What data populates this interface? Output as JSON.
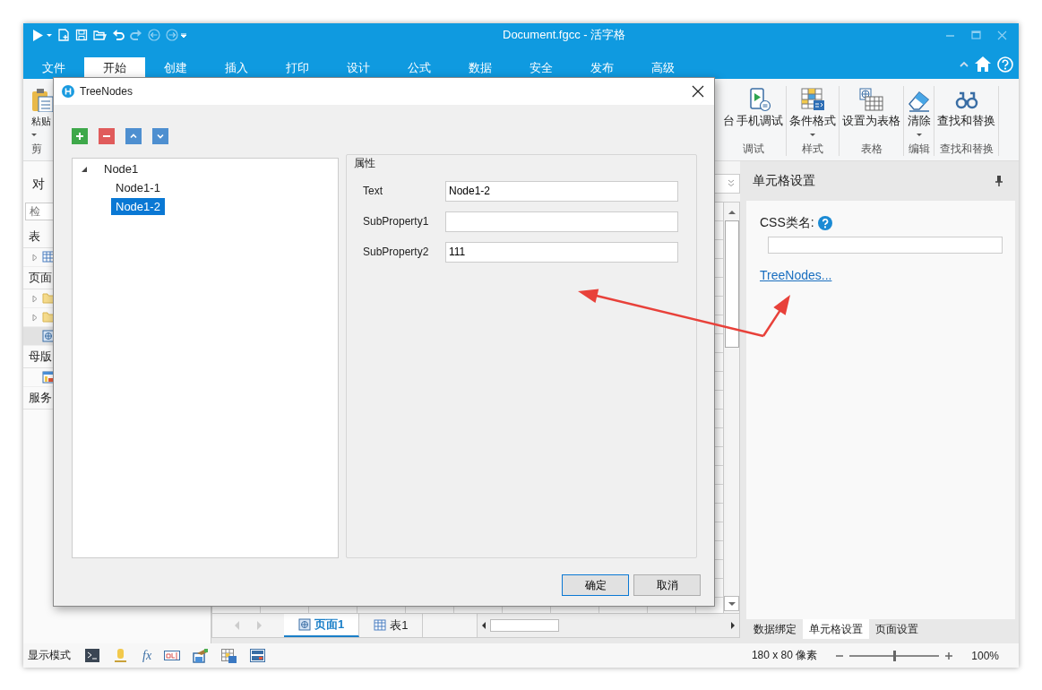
{
  "window": {
    "title": "Document.fgcc - 活字格"
  },
  "ribbon_tabs": [
    {
      "label": "文件",
      "selected": false
    },
    {
      "label": "开始",
      "selected": true
    },
    {
      "label": "创建",
      "selected": false
    },
    {
      "label": "插入",
      "selected": false
    },
    {
      "label": "打印",
      "selected": false
    },
    {
      "label": "设计",
      "selected": false
    },
    {
      "label": "公式",
      "selected": false
    },
    {
      "label": "数据",
      "selected": false
    },
    {
      "label": "安全",
      "selected": false
    },
    {
      "label": "发布",
      "selected": false
    },
    {
      "label": "高级",
      "selected": false
    }
  ],
  "ribbon_left_group": {
    "label": "剪",
    "buttons": [
      {
        "label": "粘贴",
        "kind": "clipboard",
        "dropdown": true
      }
    ]
  },
  "ribbon_groups": [
    {
      "label": "调试",
      "buttons": [
        {
          "label": "台",
          "kind": "plain",
          "dropdown": false
        },
        {
          "label": "手机调试",
          "kind": "phone",
          "dropdown": false
        }
      ]
    },
    {
      "label": "样式",
      "buttons": [
        {
          "label": "条件格式",
          "kind": "condformat",
          "dropdown": true
        }
      ]
    },
    {
      "label": "表格",
      "buttons": [
        {
          "label": "设置为表格",
          "kind": "tableglobe",
          "dropdown": false
        }
      ]
    },
    {
      "label": "编辑",
      "buttons": [
        {
          "label": "清除",
          "kind": "eraser",
          "dropdown": true
        }
      ]
    },
    {
      "label": "查找和替换",
      "buttons": [
        {
          "label": "查找和替换",
          "kind": "binoculars",
          "dropdown": false
        }
      ]
    }
  ],
  "left_panel": {
    "title": "对",
    "search": {
      "placeholder": "检"
    },
    "rows": [
      {
        "kind": "header",
        "text": "表"
      },
      {
        "kind": "table",
        "expander": true,
        "selected": false
      },
      {
        "kind": "header",
        "text": "页面"
      },
      {
        "kind": "folder",
        "expander": true,
        "selected": false
      },
      {
        "kind": "folder",
        "expander": true,
        "selected": false
      },
      {
        "kind": "page",
        "expander": false,
        "selected": true
      },
      {
        "kind": "header",
        "text": "母版"
      },
      {
        "kind": "master",
        "expander": false,
        "selected": false
      },
      {
        "kind": "header",
        "text": "服务"
      }
    ]
  },
  "sheet_tabs": [
    {
      "label": "页面1",
      "kind": "page",
      "selected": true
    },
    {
      "label": "表1",
      "kind": "table",
      "selected": false
    }
  ],
  "right_panel": {
    "title": "单元格设置",
    "css_label": "CSS类名:",
    "link": "TreeNodes...",
    "tabs": [
      {
        "label": "数据绑定",
        "selected": false
      },
      {
        "label": "单元格设置",
        "selected": true
      },
      {
        "label": "页面设置",
        "selected": false
      }
    ]
  },
  "status_bar": {
    "label": "显示模式",
    "tools": [
      {
        "kind": "console"
      },
      {
        "kind": "pin"
      },
      {
        "kind": "formula",
        "label": "fx"
      },
      {
        "kind": "textbox"
      },
      {
        "kind": "image"
      },
      {
        "kind": "grid"
      },
      {
        "kind": "layout"
      }
    ],
    "size": "180 x 80 像素",
    "zoom": {
      "level": 0.5
    },
    "zoom_text": "100%"
  },
  "dialog": {
    "title": "TreeNodes",
    "toolbar": [
      {
        "kind": "add"
      },
      {
        "kind": "remove"
      },
      {
        "kind": "up"
      },
      {
        "kind": "down"
      }
    ],
    "tree": [
      {
        "text": "Node1",
        "expanded": true,
        "selected": false,
        "children": [
          {
            "text": "Node1-1",
            "selected": false
          },
          {
            "text": "Node1-2",
            "selected": true
          }
        ]
      }
    ],
    "properties": {
      "title": "属性",
      "fields": [
        {
          "label": "Text",
          "value": "Node1-2"
        },
        {
          "label": "SubProperty1"
        },
        {
          "label": "SubProperty2",
          "value": "111"
        }
      ]
    },
    "buttons": [
      {
        "label": "确定",
        "default": true
      },
      {
        "label": "取消",
        "default": false
      }
    ]
  }
}
